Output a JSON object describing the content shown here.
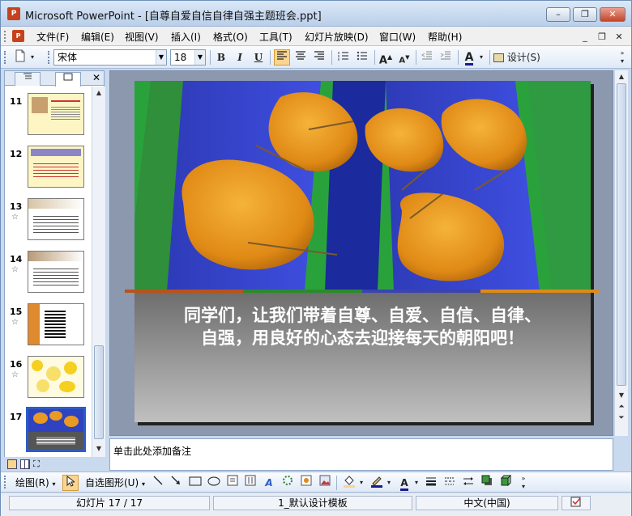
{
  "window": {
    "app_name": "Microsoft PowerPoint",
    "title": "Microsoft PowerPoint - [自尊自爱自信自律自强主题班会.ppt]",
    "minimize": "–",
    "restore": "❐",
    "close": "✕"
  },
  "menu": {
    "items": [
      "文件(F)",
      "编辑(E)",
      "视图(V)",
      "插入(I)",
      "格式(O)",
      "工具(T)",
      "幻灯片放映(D)",
      "窗口(W)",
      "帮助(H)"
    ],
    "doc_min": "_",
    "doc_restore": "❐",
    "doc_close": "✕"
  },
  "toolbar": {
    "font_name": "宋体",
    "font_size": "18",
    "bold": "B",
    "italic": "I",
    "underline": "U",
    "design_label": "设计(S)"
  },
  "panel": {
    "tab_outline_icon": "outline-icon",
    "tab_slides_icon": "slides-icon",
    "close": "✕",
    "slides": [
      {
        "num": "11",
        "star": ""
      },
      {
        "num": "12",
        "star": ""
      },
      {
        "num": "13",
        "star": "☆"
      },
      {
        "num": "14",
        "star": "☆"
      },
      {
        "num": "15",
        "star": "☆"
      },
      {
        "num": "16",
        "star": "☆"
      },
      {
        "num": "17",
        "star": ""
      }
    ]
  },
  "slide": {
    "caption": "同学们，让我们带着自尊、自爱、自信、自律、自强，用良好的心态去迎接每天的朝阳吧！"
  },
  "notes": {
    "placeholder": "单击此处添加备注"
  },
  "drawbar": {
    "draw_label": "绘图(R)",
    "autoshape_label": "自选图形(U)"
  },
  "status": {
    "slide_pos": "幻灯片 17 / 17",
    "template": "1_默认设计模板",
    "language": "中文(中国)"
  },
  "colors": {
    "accent_orange": "#fbd58f",
    "selection_blue": "#2c5cc5",
    "ppt_red": "#c6421e"
  }
}
